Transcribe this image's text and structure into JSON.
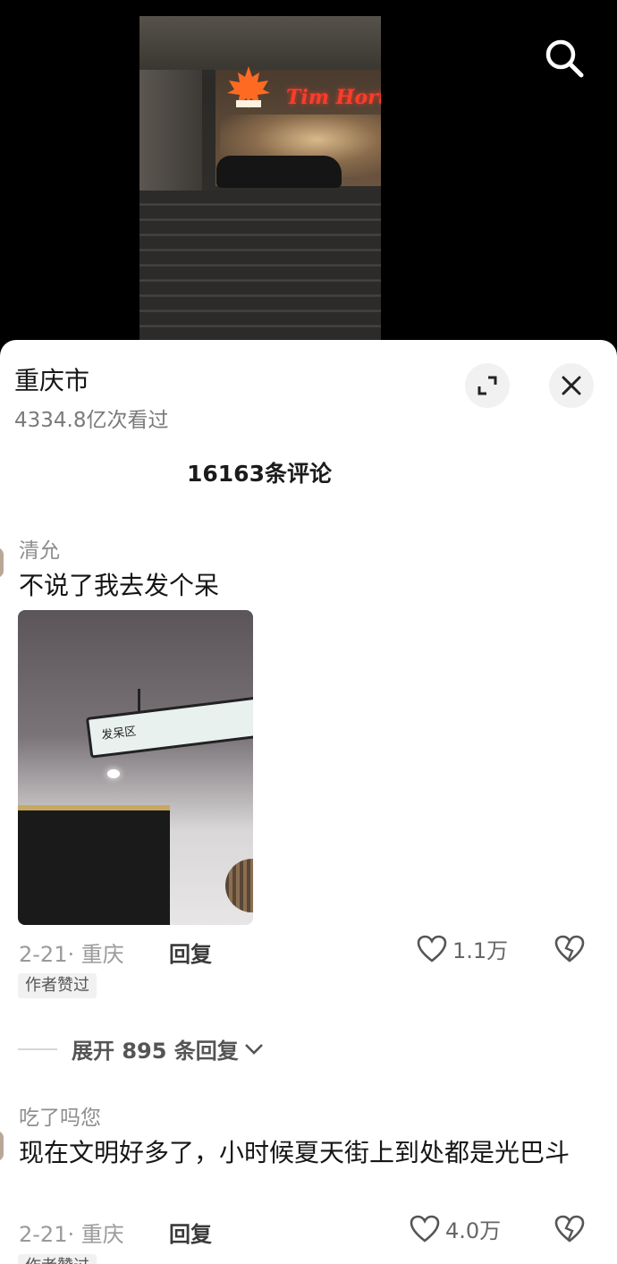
{
  "video": {
    "sign_text": "Tim Horton",
    "search_icon": "search-icon"
  },
  "panel": {
    "title": "重庆市",
    "views": "4334.8亿次看过",
    "comment_count": "16163条评论",
    "expand_icon": "expand-icon",
    "close_icon": "close-icon"
  },
  "comments": [
    {
      "author": "清允",
      "text": "不说了我去发个呆",
      "photo_sign_text": "发呆区",
      "meta": "2-21· 重庆",
      "reply_label": "回复",
      "likes": "1.1万",
      "badge": "作者赞过",
      "expand_label": "展开 895 条回复"
    },
    {
      "author": "吃了吗您",
      "text": "现在文明好多了，小时候夏天街上到处都是光巴斗",
      "meta": "2-21· 重庆",
      "reply_label": "回复",
      "likes": "4.0万",
      "badge": "作者赞过"
    }
  ]
}
